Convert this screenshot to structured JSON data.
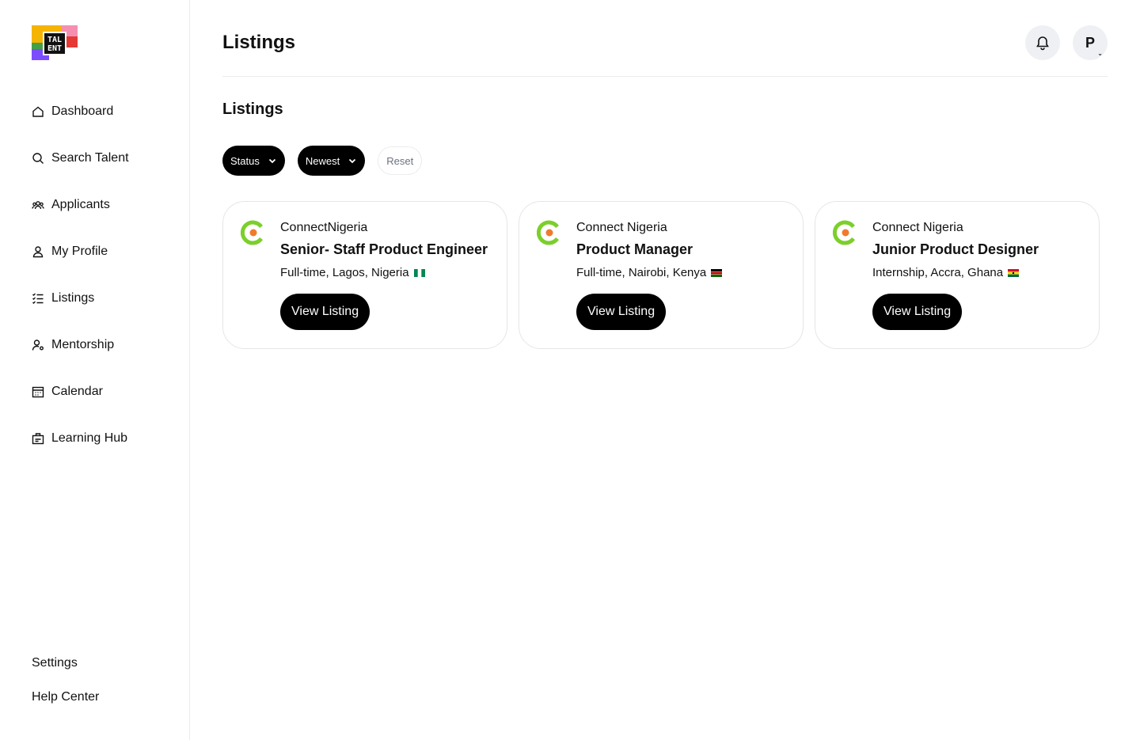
{
  "app": {
    "logo_text": "TAL ENT"
  },
  "sidebar": {
    "items": [
      {
        "label": "Dashboard",
        "icon": "home-icon"
      },
      {
        "label": "Search Talent",
        "icon": "search-icon"
      },
      {
        "label": "Applicants",
        "icon": "users-icon"
      },
      {
        "label": "My Profile",
        "icon": "user-icon"
      },
      {
        "label": "Listings",
        "icon": "list-icon"
      },
      {
        "label": "Mentorship",
        "icon": "user-gear-icon"
      },
      {
        "label": "Calendar",
        "icon": "calendar-icon"
      },
      {
        "label": "Learning Hub",
        "icon": "briefcase-icon"
      }
    ],
    "bottom": [
      {
        "label": "Settings"
      },
      {
        "label": "Help Center"
      }
    ]
  },
  "header": {
    "title": "Listings",
    "avatar_initial": "P"
  },
  "main": {
    "section_title": "Listings",
    "filters": {
      "status_label": "Status",
      "sort_label": "Newest",
      "reset_label": "Reset"
    },
    "listings": [
      {
        "company": "ConnectNigeria",
        "role": "Senior- Staff Product Engineer",
        "meta": "Full-time, Lagos, Nigeria",
        "flag": "nigeria-flag",
        "button": "View Listing"
      },
      {
        "company": "Connect Nigeria",
        "role": "Product Manager",
        "meta": "Full-time, Nairobi, Kenya",
        "flag": "kenya-flag",
        "button": "View Listing"
      },
      {
        "company": "Connect Nigeria",
        "role": "Junior Product Designer",
        "meta": "Internship, Accra, Ghana",
        "flag": "ghana-flag",
        "button": "View Listing"
      }
    ]
  },
  "colors": {
    "primary": "#000000",
    "border": "#ececec",
    "icon_bg": "#eef0f3",
    "logo_green": "#7ccf2b",
    "logo_orange": "#f07b2c"
  }
}
